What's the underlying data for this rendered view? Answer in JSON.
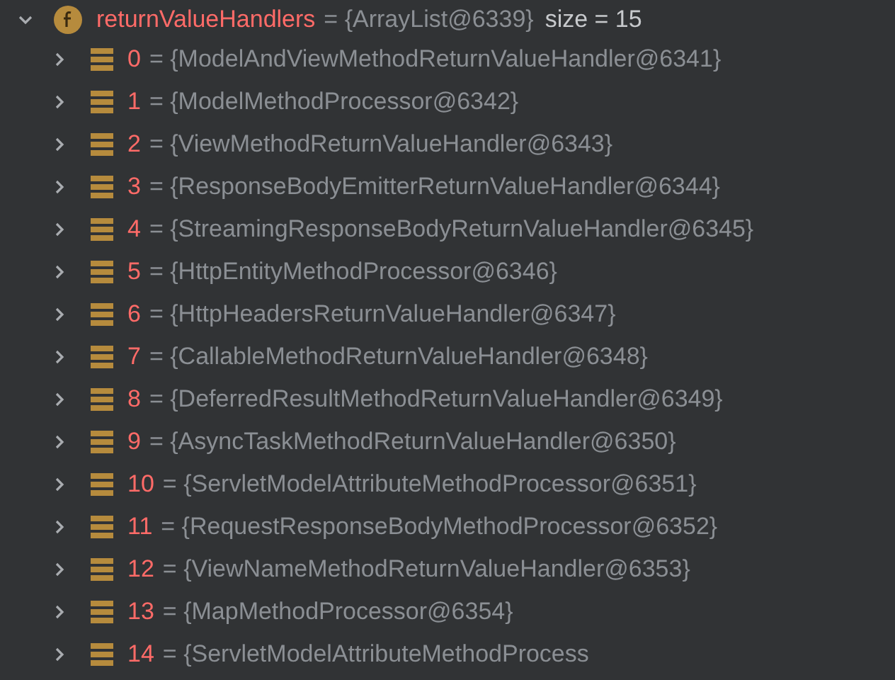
{
  "variable": {
    "name": "returnValueHandlers",
    "value": "= {ArrayList@6339}",
    "size": "size = 15",
    "expanded": true,
    "children": [
      {
        "index": "0",
        "value": "= {ModelAndViewMethodReturnValueHandler@6341}",
        "expanded": false
      },
      {
        "index": "1",
        "value": "= {ModelMethodProcessor@6342}",
        "expanded": false
      },
      {
        "index": "2",
        "value": "= {ViewMethodReturnValueHandler@6343}",
        "expanded": false
      },
      {
        "index": "3",
        "value": "= {ResponseBodyEmitterReturnValueHandler@6344}",
        "expanded": false
      },
      {
        "index": "4",
        "value": "= {StreamingResponseBodyReturnValueHandler@6345}",
        "expanded": false
      },
      {
        "index": "5",
        "value": "= {HttpEntityMethodProcessor@6346}",
        "expanded": false
      },
      {
        "index": "6",
        "value": "= {HttpHeadersReturnValueHandler@6347}",
        "expanded": false
      },
      {
        "index": "7",
        "value": "= {CallableMethodReturnValueHandler@6348}",
        "expanded": false
      },
      {
        "index": "8",
        "value": "= {DeferredResultMethodReturnValueHandler@6349}",
        "expanded": false
      },
      {
        "index": "9",
        "value": "= {AsyncTaskMethodReturnValueHandler@6350}",
        "expanded": false
      },
      {
        "index": "10",
        "value": "= {ServletModelAttributeMethodProcessor@6351}",
        "expanded": false
      },
      {
        "index": "11",
        "value": "= {RequestResponseBodyMethodProcessor@6352}",
        "expanded": false
      },
      {
        "index": "12",
        "value": "= {ViewNameMethodReturnValueHandler@6353}",
        "expanded": false
      },
      {
        "index": "13",
        "value": "= {MapMethodProcessor@6354}",
        "expanded": false
      },
      {
        "index": "14",
        "value": "= {ServletModelAttributeMethodProcess",
        "expanded": false
      }
    ]
  }
}
